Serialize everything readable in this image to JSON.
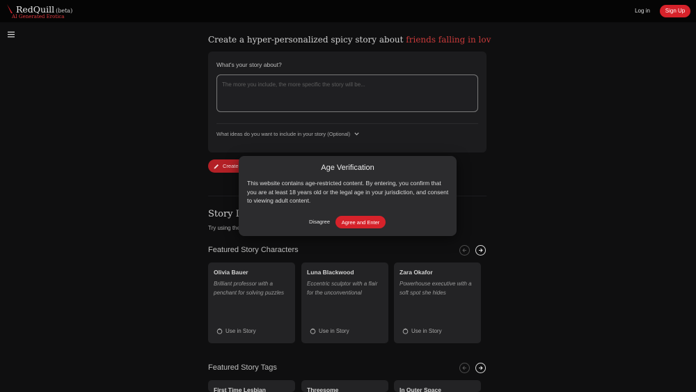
{
  "header": {
    "logo_name": "RedQuill",
    "logo_beta": "(beta)",
    "logo_subtitle": "AI Generated Erotica",
    "login_label": "Log in",
    "signup_label": "Sign Up"
  },
  "hero": {
    "headline_prefix": "Create a hyper-personalized spicy story about ",
    "headline_highlight": "friends falling in lov"
  },
  "story_form": {
    "question": "What's your story about?",
    "input_value": "",
    "input_placeholder": "The more you include, the more specific the story will be...",
    "ideas_label": "What ideas do you want to include in your story (Optional)",
    "create_label": "Create"
  },
  "story_ideas": {
    "title": "Story Ideas",
    "subtitle": "Try using these"
  },
  "featured_characters": {
    "title": "Featured Story Characters",
    "use_label": "Use in Story",
    "items": [
      {
        "name": "Olivia Bauer",
        "description": "Brilliant professor with a penchant for solving puzzles"
      },
      {
        "name": "Luna Blackwood",
        "description": "Eccentric sculptor with a flair for the unconventional"
      },
      {
        "name": "Zara Okafor",
        "description": "Powerhouse executive with a soft spot she hides"
      }
    ]
  },
  "featured_tags": {
    "title": "Featured Story Tags",
    "items": [
      {
        "name": "First Time Lesbian"
      },
      {
        "name": "Threesome"
      },
      {
        "name": "In Outer Space"
      }
    ]
  },
  "age_modal": {
    "title": "Age Verification",
    "body": "This website contains age-restricted content. By entering, you confirm that you are at least 18 years old or the legal age in your jurisdiction, and consent to viewing adult content.",
    "disagree_label": "Disagree",
    "agree_label": "Agree and Enter"
  },
  "colors": {
    "accent": "#d6222a",
    "background": "#0f0f10",
    "card": "#232325",
    "modal": "#2c2c2e"
  },
  "icons": {
    "menu": "hamburger-menu-icon",
    "pencil": "pencil-icon",
    "chevron": "chevron-down-icon",
    "prev": "arrow-left-circle-icon",
    "next": "arrow-right-circle-icon",
    "use": "hand-icon"
  }
}
